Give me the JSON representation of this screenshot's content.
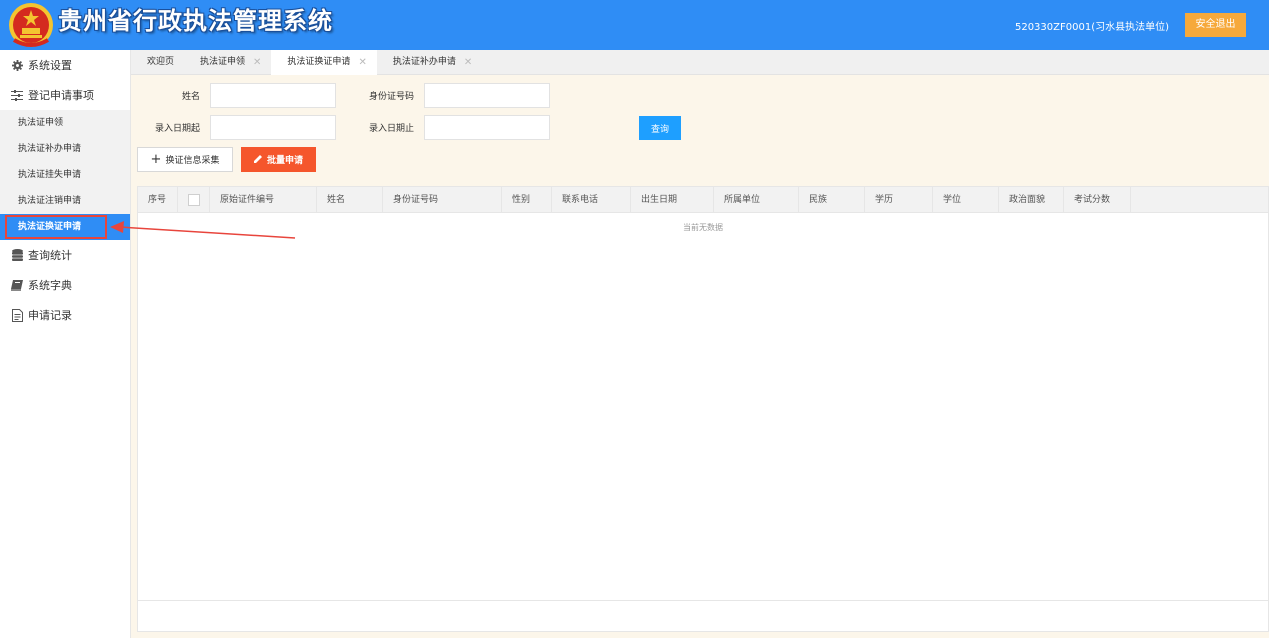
{
  "header": {
    "title": "贵州省行政执法管理系统",
    "user": "520330ZF0001(习水县执法单位)",
    "logout_label": "安全退出"
  },
  "sidebar": {
    "sections": [
      {
        "label": "系统设置",
        "icon": "gear-icon"
      },
      {
        "label": "登记申请事项",
        "icon": "sliders-icon"
      }
    ],
    "sub_items": [
      {
        "label": "执法证申领"
      },
      {
        "label": "执法证补办申请"
      },
      {
        "label": "执法证挂失申请"
      },
      {
        "label": "执法证注销申请"
      },
      {
        "label": "执法证换证申请",
        "active": true
      }
    ],
    "bottom_sections": [
      {
        "label": "查询统计",
        "icon": "database-icon"
      },
      {
        "label": "系统字典",
        "icon": "book-icon"
      },
      {
        "label": "申请记录",
        "icon": "document-icon"
      }
    ]
  },
  "tabs": [
    {
      "label": "欢迎页",
      "closable": false
    },
    {
      "label": "执法证申领",
      "closable": true
    },
    {
      "label": "执法证换证申请",
      "closable": true,
      "active": true
    },
    {
      "label": "执法证补办申请",
      "closable": true
    }
  ],
  "form": {
    "name_label": "姓名",
    "name_value": "",
    "id_label": "身份证号码",
    "id_value": "",
    "date_from_label": "录入日期起",
    "date_from_value": "",
    "date_to_label": "录入日期止",
    "date_to_value": "",
    "query_label": "查询"
  },
  "actions": {
    "collect_label": "换证信息采集",
    "batch_label": "批量申请"
  },
  "table": {
    "columns": [
      "序号",
      "",
      "原始证件编号",
      "姓名",
      "身份证号码",
      "性别",
      "联系电话",
      "出生日期",
      "所属单位",
      "民族",
      "学历",
      "学位",
      "政治面貌",
      "考试分数"
    ],
    "empty_text": "当前无数据"
  },
  "colors": {
    "header_bg": "#2f8df5",
    "logout_bg": "#f6a93b",
    "query_bg": "#1e9fff",
    "batch_bg": "#f5562c",
    "highlight": "#e8453c"
  }
}
